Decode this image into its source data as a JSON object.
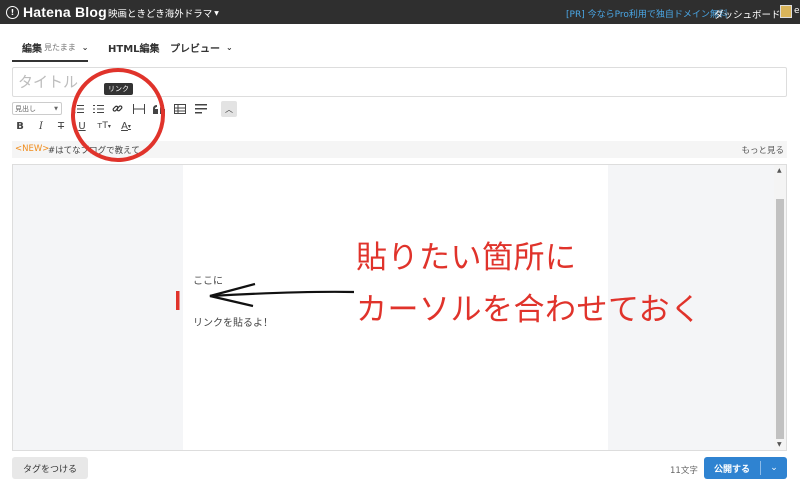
{
  "topbar": {
    "brand": "Hatena Blog",
    "blog_name": "映画ときどき海外ドラマ",
    "pr_link": "[PR] 今ならPro利用で独自ドメイン無料",
    "dashboard": "ダッシュボード",
    "user_truncated": "e"
  },
  "tabs": [
    {
      "label": "編集",
      "sub": "見たまま"
    },
    {
      "label": "HTML編集"
    },
    {
      "label": "プレビュー"
    }
  ],
  "title_placeholder": "タイトル",
  "toolbar": {
    "heading_select": "見出し",
    "tooltip": "リンク",
    "icons": [
      "unordered-list-icon",
      "ordered-list-icon",
      "link-icon",
      "horizontal-rule-icon",
      "blockquote-icon",
      "table-icon",
      "more-icon",
      "collapse-icon",
      "bold-icon",
      "italic-icon",
      "strikethrough-icon",
      "underline-icon",
      "font-size-icon",
      "font-color-icon"
    ]
  },
  "infobar": {
    "badge": "<NEW>",
    "message": "#はてなブログで教えて",
    "more": "もっと見る"
  },
  "editor": {
    "line1": "ここに",
    "line2": "リンクを貼るよ！"
  },
  "footer": {
    "tag_button": "タグをつける",
    "char_count": "11文字",
    "publish": "公開する"
  },
  "annotations": {
    "line1": "貼りたい箇所に",
    "line2": "カーソルを合わせておく",
    "color": "#e0332b"
  },
  "colors": {
    "topbar": "#2f2f2f",
    "accent": "#2f83d1",
    "new_badge": "#f08c1b",
    "pr_link": "#4aa7e6"
  }
}
